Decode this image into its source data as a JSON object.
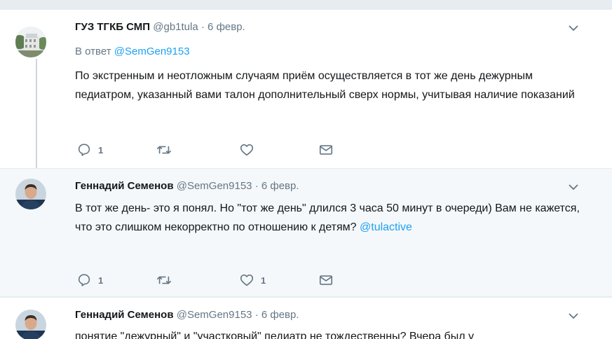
{
  "tweets": [
    {
      "name": "ГУЗ ТГКБ СМП",
      "handle": "@gb1tula",
      "date": "· 6 февр.",
      "reply_prefix": "В ответ",
      "reply_handle": "@SemGen9153",
      "text": "По экстренным и неотложным случаям приём осуществляется в тот же день дежурным педиатром, указанный вами талон дополнительный сверх нормы, учитывая наличие показаний",
      "reply_count": "1",
      "retweet_count": "",
      "like_count": ""
    },
    {
      "name": "Геннадий Семенов",
      "handle": "@SemGen9153",
      "date": "· 6 февр.",
      "text": "В тот же день- это я понял. Но \"тот же день\" длился 3 часа 50 минут в очереди)  Вам не кажется, что это слишком некорректно по отношению к детям? ",
      "mention": "@tulactive",
      "reply_count": "1",
      "retweet_count": "",
      "like_count": "1"
    },
    {
      "name": "Геннадий Семенов",
      "handle": "@SemGen9153",
      "date": "· 6 февр.",
      "text": "понятие \"дежурный\" и \"участковый\" педиатр не тождественны? Вчера был у"
    }
  ],
  "icons": {
    "reply": "reply-icon",
    "retweet": "retweet-icon",
    "like": "heart-icon",
    "dm": "envelope-icon",
    "caret": "chevron-down-icon"
  },
  "colors": {
    "link": "#1da1f2",
    "muted": "#657786",
    "thread_line": "#ccd6dd",
    "background": "#e6ecf0"
  }
}
